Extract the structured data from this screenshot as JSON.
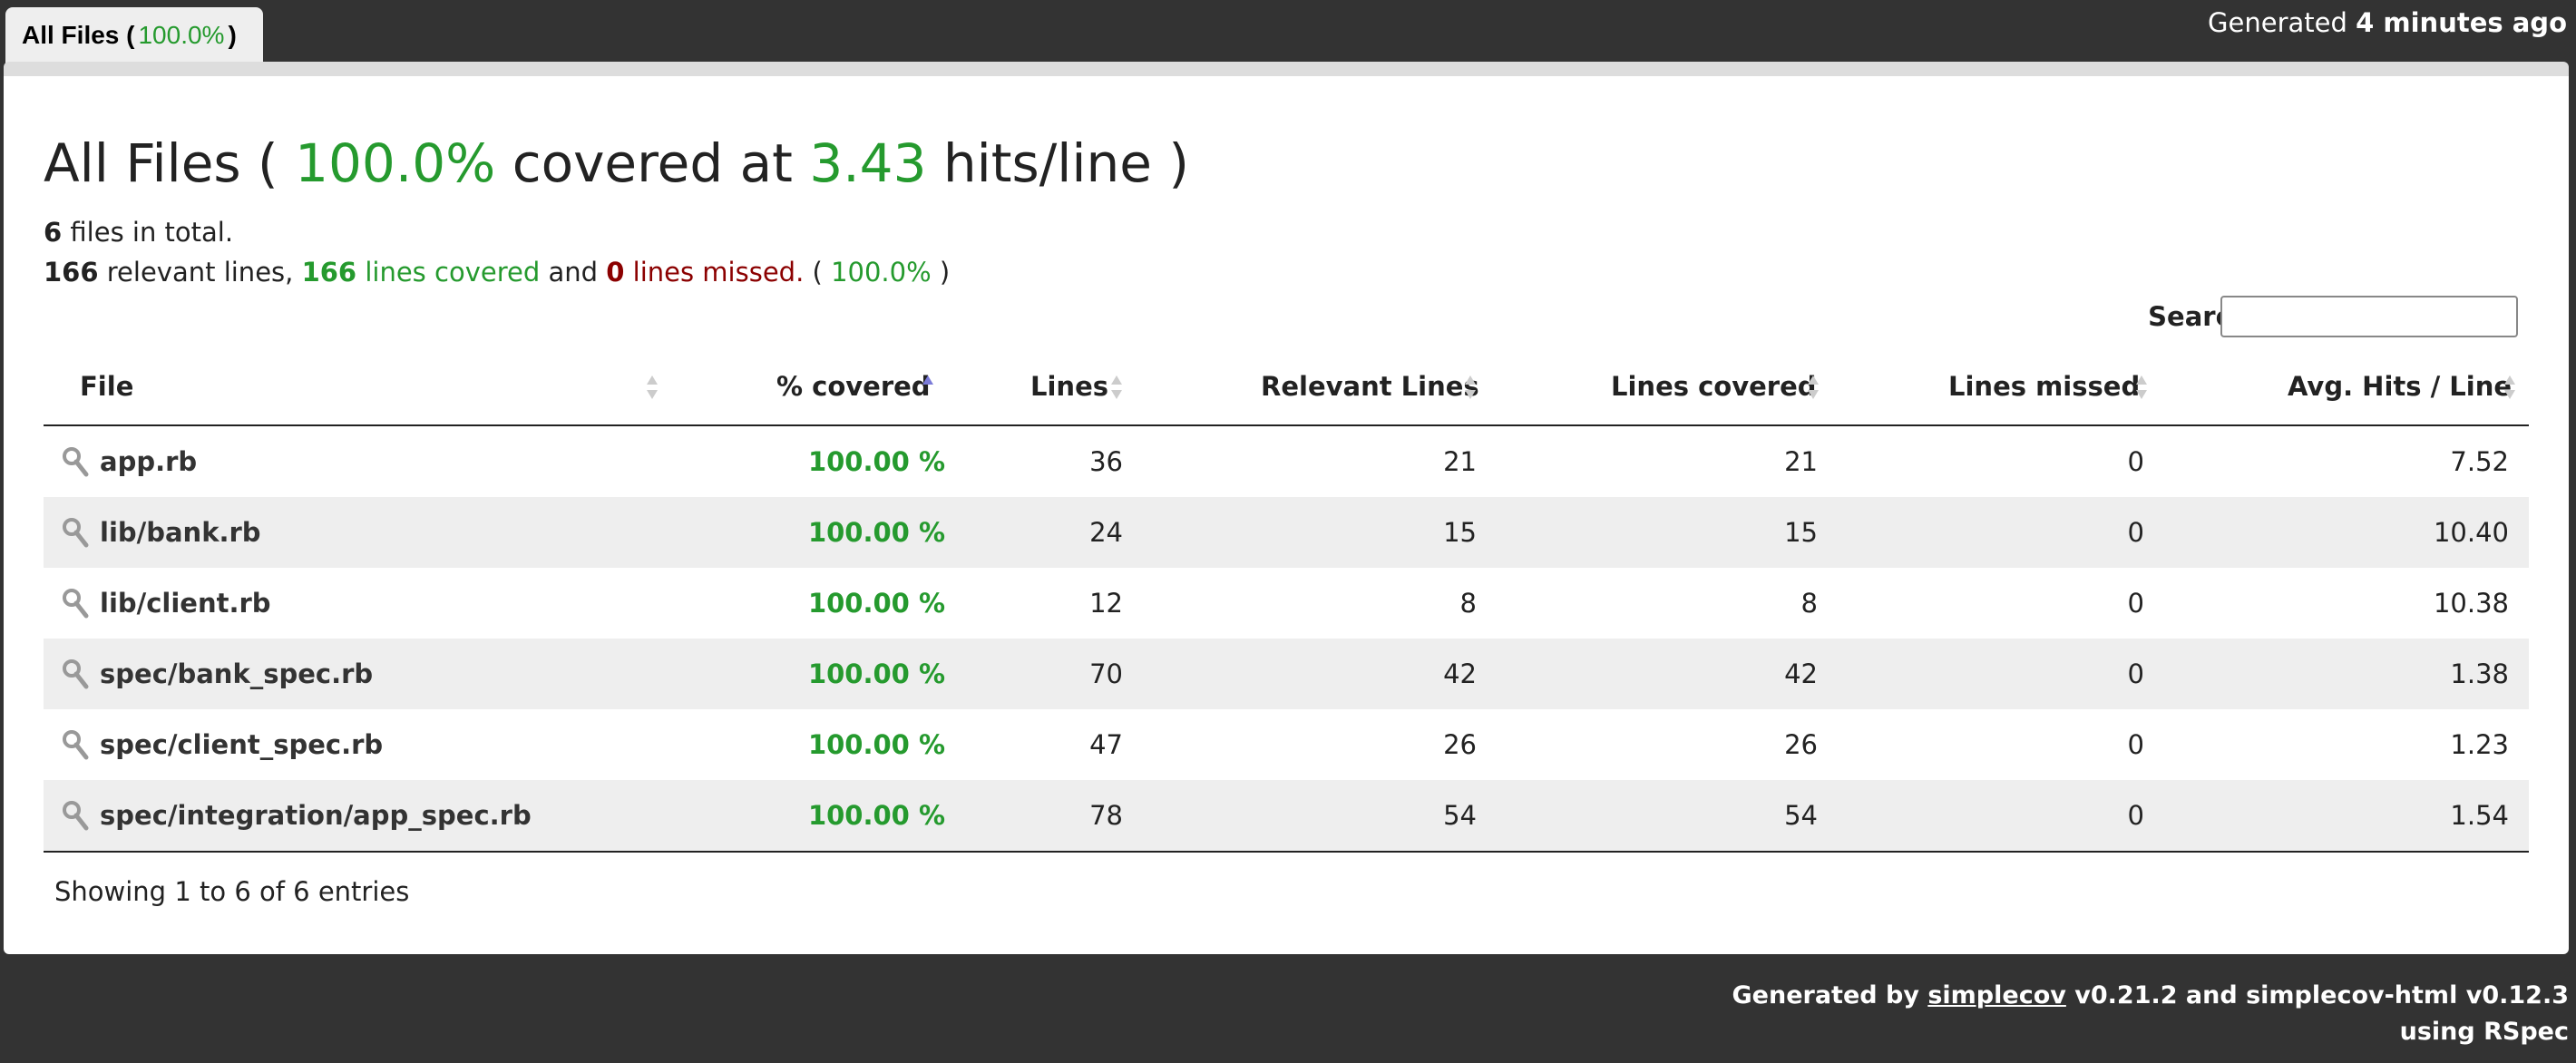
{
  "header": {
    "tab_label": "All Files",
    "tab_pct": "100.0%",
    "generated_prefix": "Generated",
    "generated_ago": "4 minutes ago"
  },
  "summary": {
    "title_prefix": "All Files (",
    "title_pct": "100.0%",
    "title_mid": "covered at",
    "title_hits": "3.43",
    "title_suffix": "hits/line )",
    "files_count": "6",
    "files_text": "files in total.",
    "relevant_count": "166",
    "relevant_text": "relevant lines,",
    "covered_count": "166",
    "covered_text": "lines covered",
    "and_text": "and",
    "missed_count": "0",
    "missed_text": "lines missed.",
    "total_pct": "100.0%"
  },
  "search": {
    "label": "Search:",
    "value": ""
  },
  "table": {
    "columns": [
      "File",
      "% covered",
      "Lines",
      "Relevant Lines",
      "Lines covered",
      "Lines missed",
      "Avg. Hits / Line"
    ],
    "sorted_column": "% covered",
    "rows": [
      {
        "file": "app.rb",
        "covered": "100.00 %",
        "lines": "36",
        "relevant": "21",
        "lines_covered": "21",
        "missed": "0",
        "avg": "7.52"
      },
      {
        "file": "lib/bank.rb",
        "covered": "100.00 %",
        "lines": "24",
        "relevant": "15",
        "lines_covered": "15",
        "missed": "0",
        "avg": "10.40"
      },
      {
        "file": "lib/client.rb",
        "covered": "100.00 %",
        "lines": "12",
        "relevant": "8",
        "lines_covered": "8",
        "missed": "0",
        "avg": "10.38"
      },
      {
        "file": "spec/bank_spec.rb",
        "covered": "100.00 %",
        "lines": "70",
        "relevant": "42",
        "lines_covered": "42",
        "missed": "0",
        "avg": "1.38"
      },
      {
        "file": "spec/client_spec.rb",
        "covered": "100.00 %",
        "lines": "47",
        "relevant": "26",
        "lines_covered": "26",
        "missed": "0",
        "avg": "1.23"
      },
      {
        "file": "spec/integration/app_spec.rb",
        "covered": "100.00 %",
        "lines": "78",
        "relevant": "54",
        "lines_covered": "54",
        "missed": "0",
        "avg": "1.54"
      }
    ],
    "showing": "Showing 1 to 6 of 6 entries"
  },
  "footer": {
    "prefix": "Generated by",
    "link": "simplecov",
    "suffix": "v0.21.2 and simplecov-html v0.12.3",
    "line2": "using RSpec"
  },
  "colors": {
    "background": "#333333",
    "covered_green": "#259a2e",
    "missed_red": "#8b0000",
    "row_stripe": "#eeeeee"
  },
  "icons": {
    "row_icon": "magnifier-icon",
    "sort_icon": "sort-arrows-icon"
  }
}
